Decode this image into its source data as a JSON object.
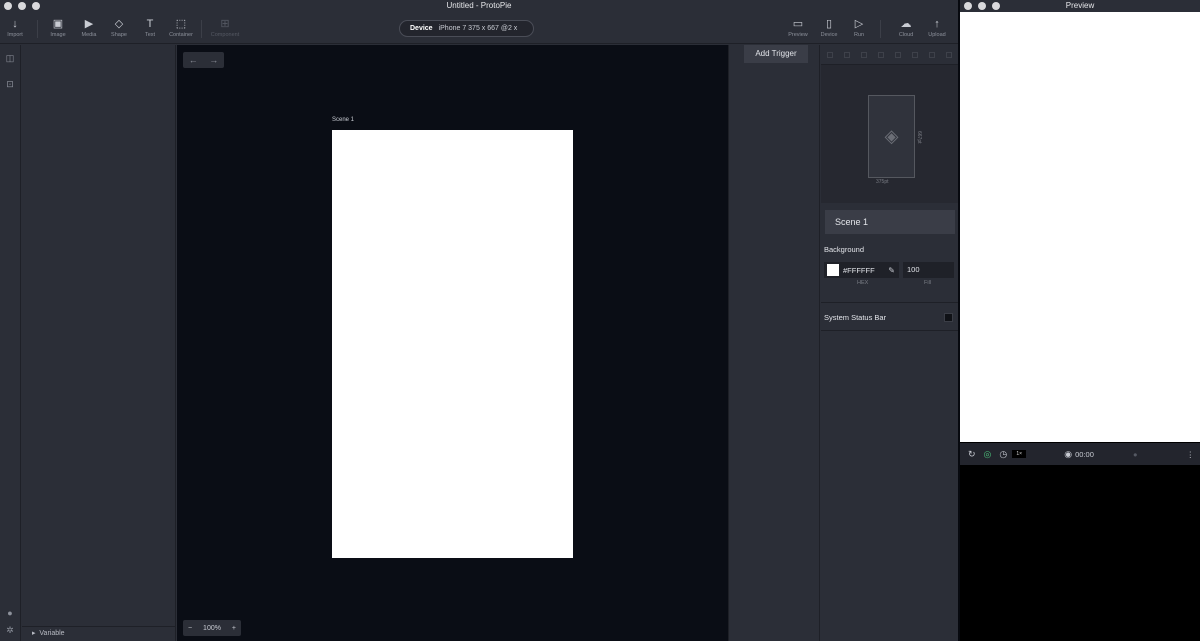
{
  "window": {
    "title": "Untitled - ProtoPie"
  },
  "toolbar": {
    "items": [
      {
        "label": "Import",
        "icon": "↓"
      },
      {
        "label": "Image",
        "icon": "▣"
      },
      {
        "label": "Media",
        "icon": "▶"
      },
      {
        "label": "Shape",
        "icon": "◇"
      },
      {
        "label": "Text",
        "icon": "T"
      },
      {
        "label": "Container",
        "icon": "⬚"
      },
      {
        "label": "Component",
        "icon": "⊞"
      }
    ],
    "right_items": [
      {
        "label": "Preview",
        "icon": "▭"
      },
      {
        "label": "Device",
        "icon": "▯"
      },
      {
        "label": "Run",
        "icon": "▷"
      },
      {
        "label": "Cloud",
        "icon": "☁"
      },
      {
        "label": "Upload",
        "icon": "↑"
      }
    ],
    "device": {
      "label": "Device",
      "value": "iPhone 7  375 x 667  @2 x"
    }
  },
  "layers": {
    "variable_label": "Variable"
  },
  "canvas": {
    "scene_label": "Scene 1",
    "zoom": "100%",
    "zoom_minus": "−",
    "zoom_plus": "+",
    "back": "←",
    "forward": "→"
  },
  "triggers": {
    "add_label": "Add Trigger"
  },
  "properties": {
    "thumb_width": "375pt",
    "thumb_height": "667pt",
    "scene_name": "Scene 1",
    "background_label": "Background",
    "hex_value": "#FFFFFF",
    "fill_value": "100",
    "hex_caption": "HEX",
    "fill_caption": "Fill",
    "status_bar_label": "System Status Bar",
    "background_color": "#FFFFFF"
  },
  "preview": {
    "title": "Preview",
    "speed": "1×",
    "timer": "00:00"
  }
}
